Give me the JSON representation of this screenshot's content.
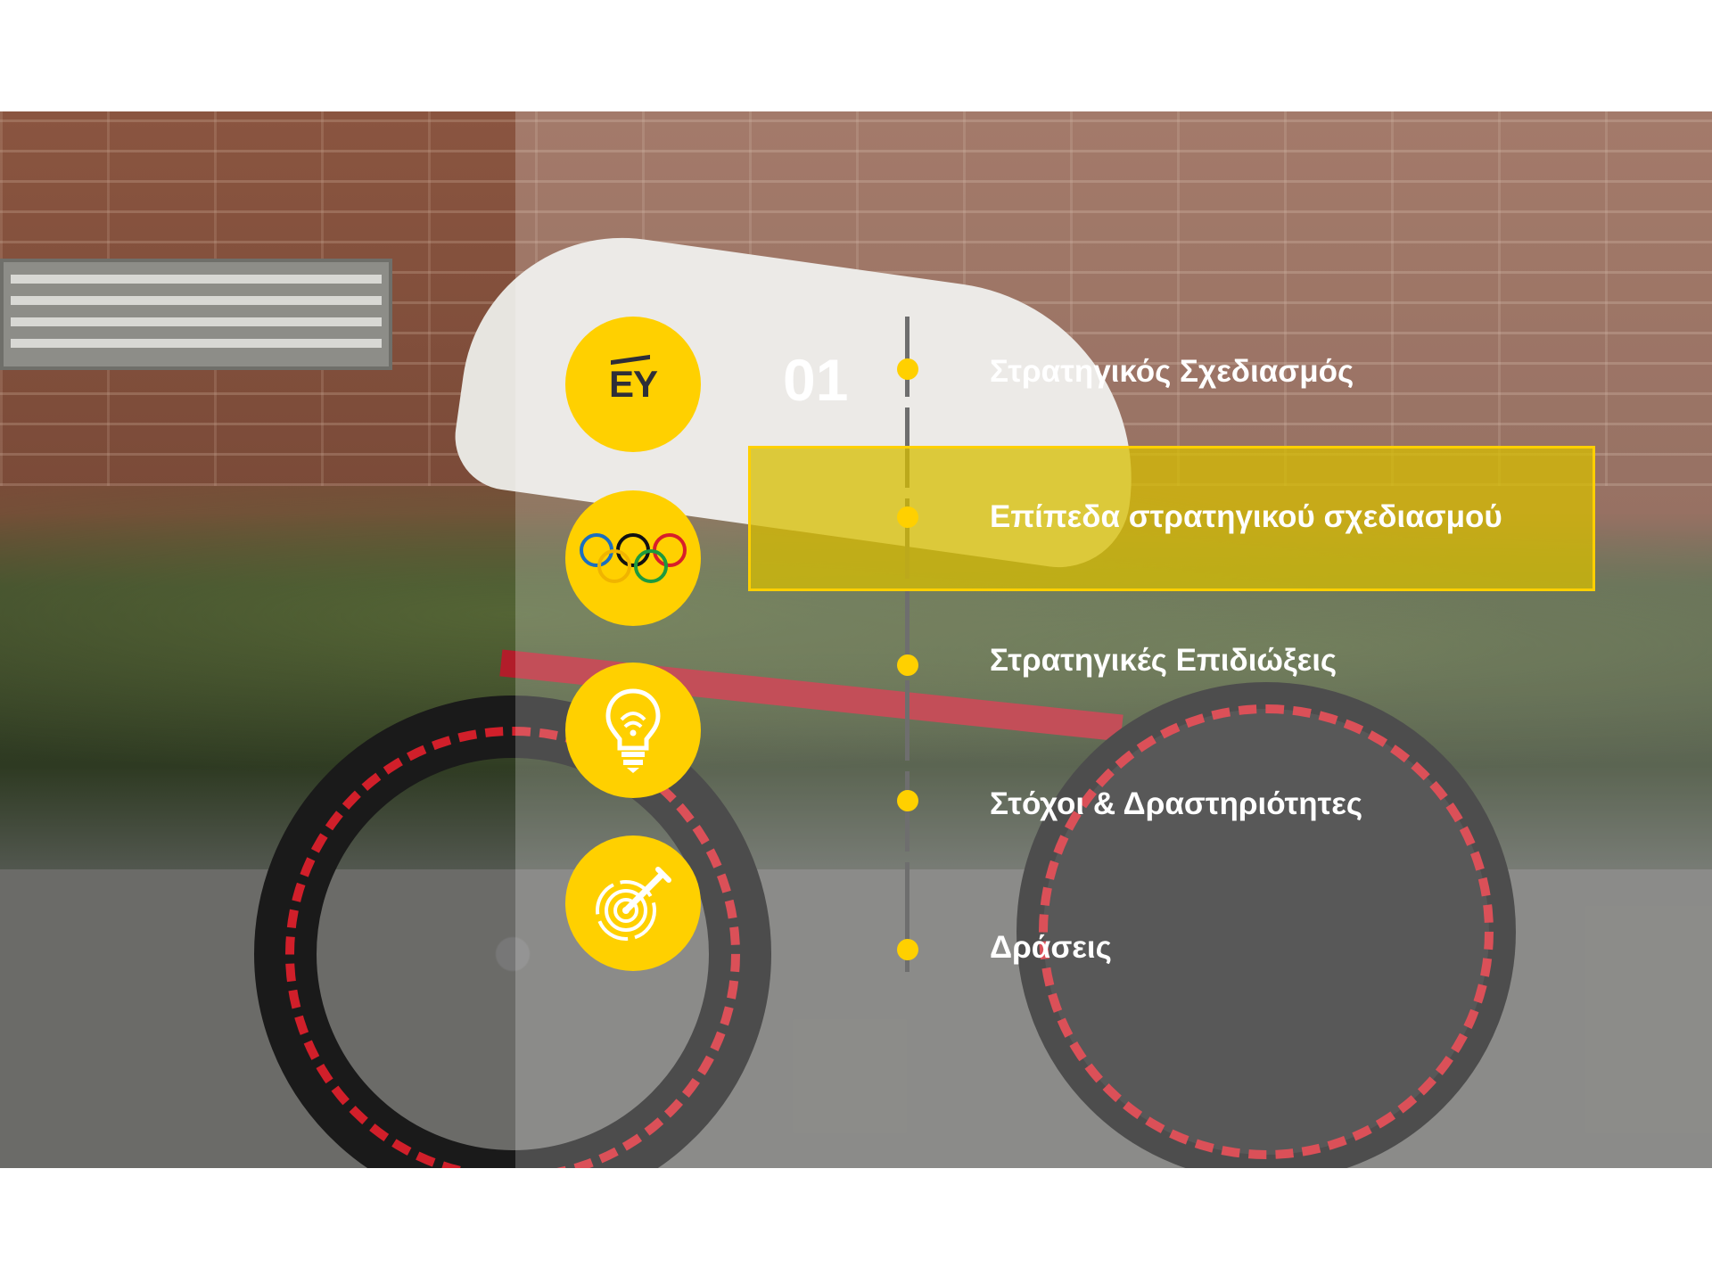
{
  "slide": {
    "number": "01",
    "logo_text": "EY",
    "accent_color": "#ffd000",
    "items": [
      {
        "label": "Στρατηγικός Σχεδιασμός",
        "active": false
      },
      {
        "label": "Επίπεδα στρατηγικού σχεδιασμού",
        "active": true
      },
      {
        "label": "Στρατηγικές Επιδιώξεις",
        "active": false
      },
      {
        "label": "Στόχοι & Δραστηριότητες",
        "active": false
      },
      {
        "label": "Δράσεις",
        "active": false
      }
    ],
    "icons": [
      "ey-logo",
      "olympic-rings-icon",
      "lightbulb-icon",
      "target-pencil-icon"
    ]
  }
}
